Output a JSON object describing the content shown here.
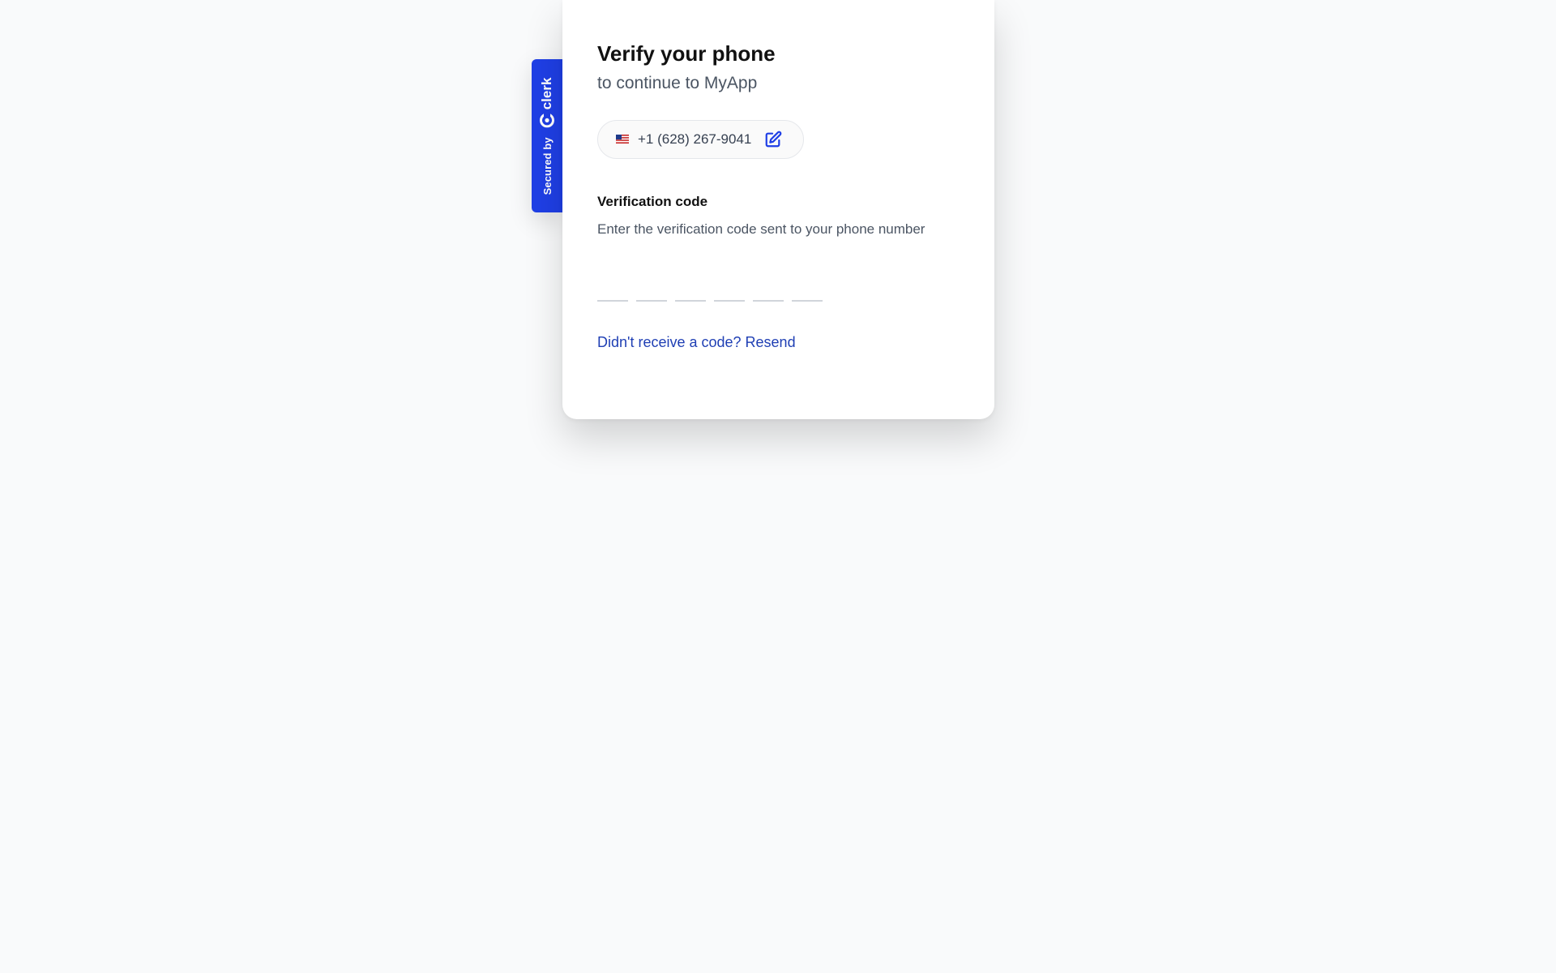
{
  "badge": {
    "secured_by": "Secured by",
    "brand": "clerk"
  },
  "header": {
    "title": "Verify your phone",
    "subtitle": "to continue to MyApp"
  },
  "identity": {
    "flag_icon": "us-flag-icon",
    "phone": "+1 (628) 267-9041",
    "edit_icon": "edit-icon"
  },
  "verification": {
    "label": "Verification code",
    "hint": "Enter the verification code sent to your phone number",
    "digits": [
      "",
      "",
      "",
      "",
      "",
      ""
    ]
  },
  "resend": {
    "text": "Didn't receive a code? Resend"
  },
  "colors": {
    "accent": "#1f3fe6",
    "link": "#1f3fb4",
    "background": "#f9fafb"
  }
}
